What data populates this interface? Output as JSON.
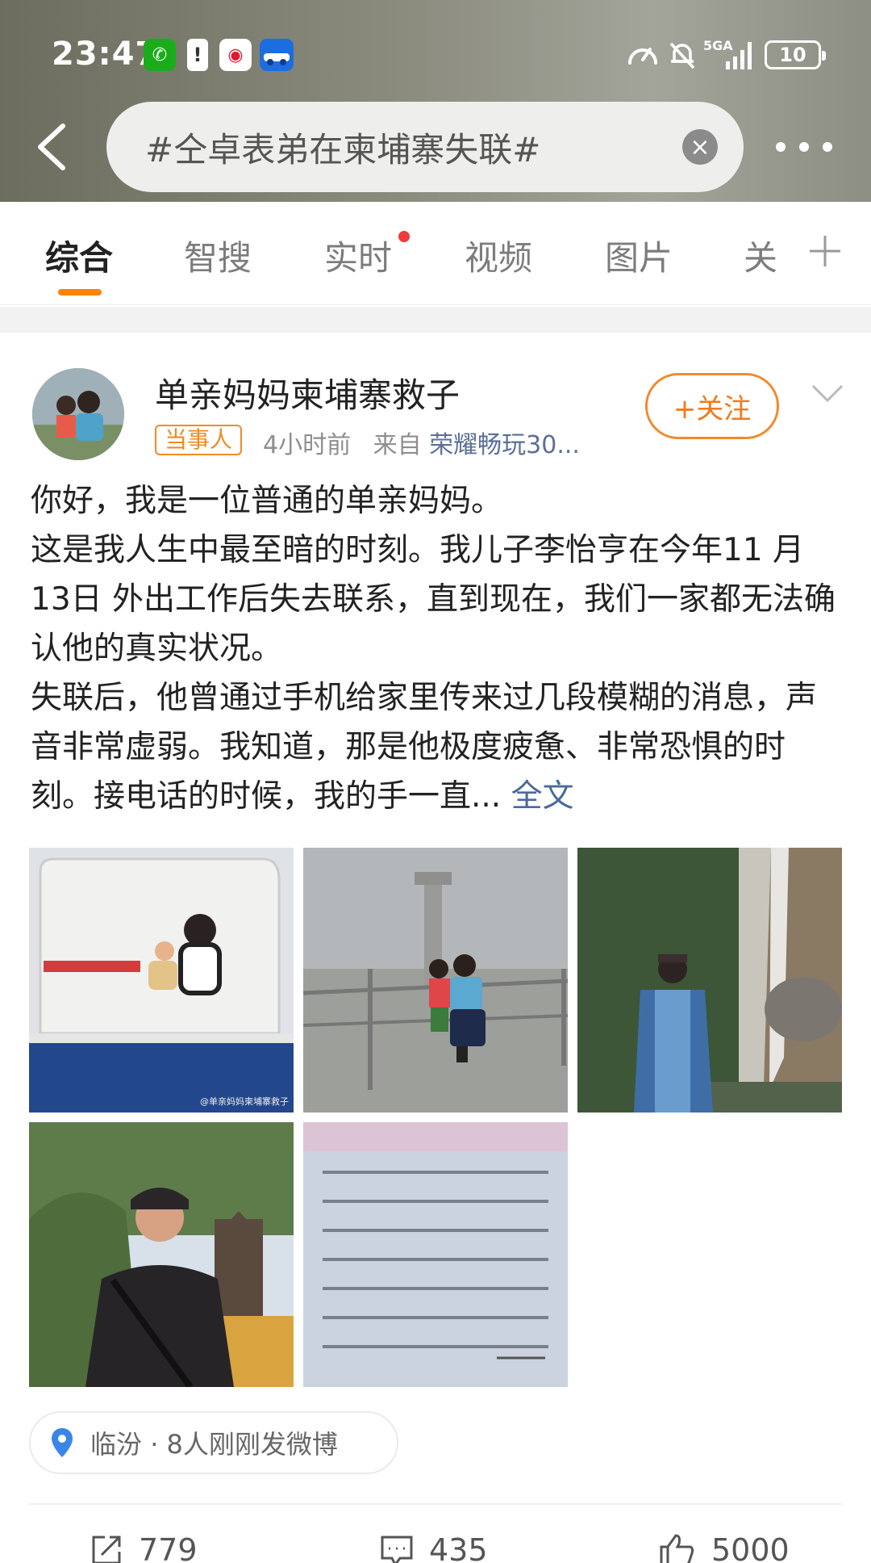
{
  "status_bar": {
    "time": "23:47",
    "network": "5GA",
    "battery": "10",
    "app_icons": [
      "wechat-icon",
      "battery-alert-icon",
      "weibo-icon",
      "autohome-icon"
    ],
    "autohome_label": "汽车之家"
  },
  "search": {
    "query": "#仝卓表弟在柬埔寨失联#"
  },
  "tabs": [
    {
      "label": "综合",
      "active": true
    },
    {
      "label": "智搜"
    },
    {
      "label": "实时",
      "has_dot": true
    },
    {
      "label": "视频"
    },
    {
      "label": "图片"
    },
    {
      "label": "关"
    }
  ],
  "post": {
    "username": "单亲妈妈柬埔寨救子",
    "badge": "当事人",
    "time": "4小时前",
    "source_prefix": "来自",
    "source": "荣耀畅玩30...",
    "follow_label": "+关注",
    "body": [
      "你好，我是一位普通的单亲妈妈。",
      "这是我人生中最至暗的时刻。我儿子李怡亨在今年11 月 13日 外出工作后失去联系，直到现在，我们一家都无法确认他的真实状况。",
      "失联后，他曾通过手机给家里传来过几段模糊的消息，声音非常虚弱。我知道，那是他极度疲惫、非常恐惧的时刻。接电话的时候，我的手一直..."
    ],
    "full_text_label": "全文",
    "watermark": "@单亲妈妈柬埔寨救子",
    "location": {
      "place": "临汾",
      "sep": "·",
      "text": "8人刚刚发微博"
    },
    "actions": {
      "reposts": "779",
      "comments": "435",
      "likes": "5000"
    }
  },
  "colors": {
    "accent": "#ff8200",
    "badge": "#ef8b24",
    "link": "#4a6a9c"
  }
}
